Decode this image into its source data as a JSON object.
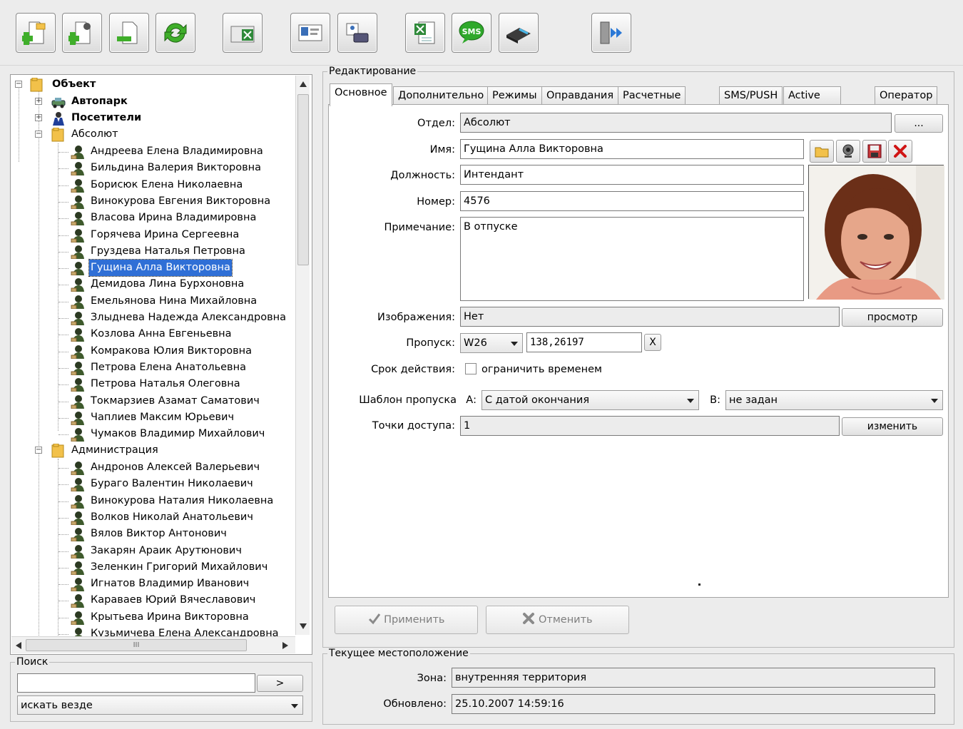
{
  "toolbar": {
    "buttons": [
      {
        "icon": "add-folder-icon"
      },
      {
        "icon": "add-person-icon"
      },
      {
        "icon": "remove-icon"
      },
      {
        "icon": "refresh-icon"
      },
      {
        "icon": "excel-card-icon"
      },
      {
        "icon": "id-card-icon"
      },
      {
        "icon": "scanner-person-icon"
      },
      {
        "icon": "excel-export-icon"
      },
      {
        "icon": "sms-icon"
      },
      {
        "icon": "card-reader-icon"
      },
      {
        "icon": "exit-door-icon"
      }
    ],
    "sms_text": "SMS"
  },
  "tree": {
    "root": "Объект",
    "groups": [
      "Автопарк",
      "Посетители"
    ],
    "dept1": "Абсолют",
    "dept1_people": [
      "Андреева Елена Владимировна",
      "Бильдина Валерия Викторовна",
      "Борисюк Елена Николаевна",
      "Винокурова Евгения Викторовна",
      "Власова Ирина Владимировна",
      "Горячева Ирина Сергеевна",
      "Груздева Наталья Петровна",
      "Гущина Алла Викторовна",
      "Демидова Лина Бурхоновна",
      "Емельянова  Нина Михайловна",
      "Злыднева Надежда Александровна",
      "Козлова Анна Евгеньевна",
      "Комракова Юлия Викторовна",
      "Петрова Елена Анатольевна",
      "Петрова Наталья Олеговна",
      "Токмарзиев Азамат Саматович",
      "Чаплиев Максим Юрьевич",
      "Чумаков Владимир Михайлович"
    ],
    "dept2": "Администрация",
    "dept2_people": [
      "Андронов Алексей Валерьевич",
      "Бураго Валентин Николаевич",
      "Винокурова Наталия Николаевна",
      "Волков Николай Анатольевич",
      "Вялов Виктор Антонович",
      "Закарян Араик Арутюнович",
      "Зеленкин Григорий Михайлович",
      "Игнатов Владимир Иванович",
      "Караваев Юрий Вячеславович",
      "Крытьева Ирина Викторовна",
      "Кузьмичева Елена Александровна"
    ],
    "selected": "Гущина Алла Викторовна",
    "hscroll_mark": "III"
  },
  "search": {
    "legend": "Поиск",
    "value": "",
    "go_label": ">",
    "scope": "искать везде"
  },
  "edit": {
    "legend": "Редактирование",
    "tabs": [
      "Основное",
      "Дополнительно",
      "Режимы",
      "Оправдания",
      "Расчетные счета",
      "SMS/PUSH",
      "Active Directory",
      "Оператор"
    ],
    "active_tab": "Основное",
    "labels": {
      "department": "Отдел:",
      "name": "Имя:",
      "position": "Должность:",
      "number": "Номер:",
      "note": "Примечание:",
      "images": "Изображения:",
      "pass": "Пропуск:",
      "validity": "Срок действия:",
      "template": "Шаблон пропуска",
      "template_a": "А:",
      "template_b": "В:",
      "access_points": "Точки доступа:"
    },
    "values": {
      "department": "Абсолют",
      "name": "Гущина Алла Викторовна",
      "position": "Интендант",
      "number": "4576",
      "note": "В отпуске",
      "images": "Нет",
      "pass_type": "W26",
      "pass_code": "138,26197",
      "validity_checkbox": "ограничить временем",
      "validity_checked": false,
      "template_a": "С датой окончания",
      "template_b": "не задан",
      "access_points": "1"
    },
    "buttons": {
      "browse": "...",
      "view": "просмотр",
      "clear": "X",
      "change": "изменить",
      "apply": "Применить",
      "cancel": "Отменить"
    },
    "photo_buttons": [
      "folder-icon",
      "webcam-icon",
      "save-icon",
      "delete-icon"
    ]
  },
  "location": {
    "legend": "Текущее местоположение",
    "zone_label": "Зона:",
    "zone": "внутренняя территория",
    "updated_label": "Обновлено:",
    "updated": "25.10.2007 14:59:16"
  }
}
